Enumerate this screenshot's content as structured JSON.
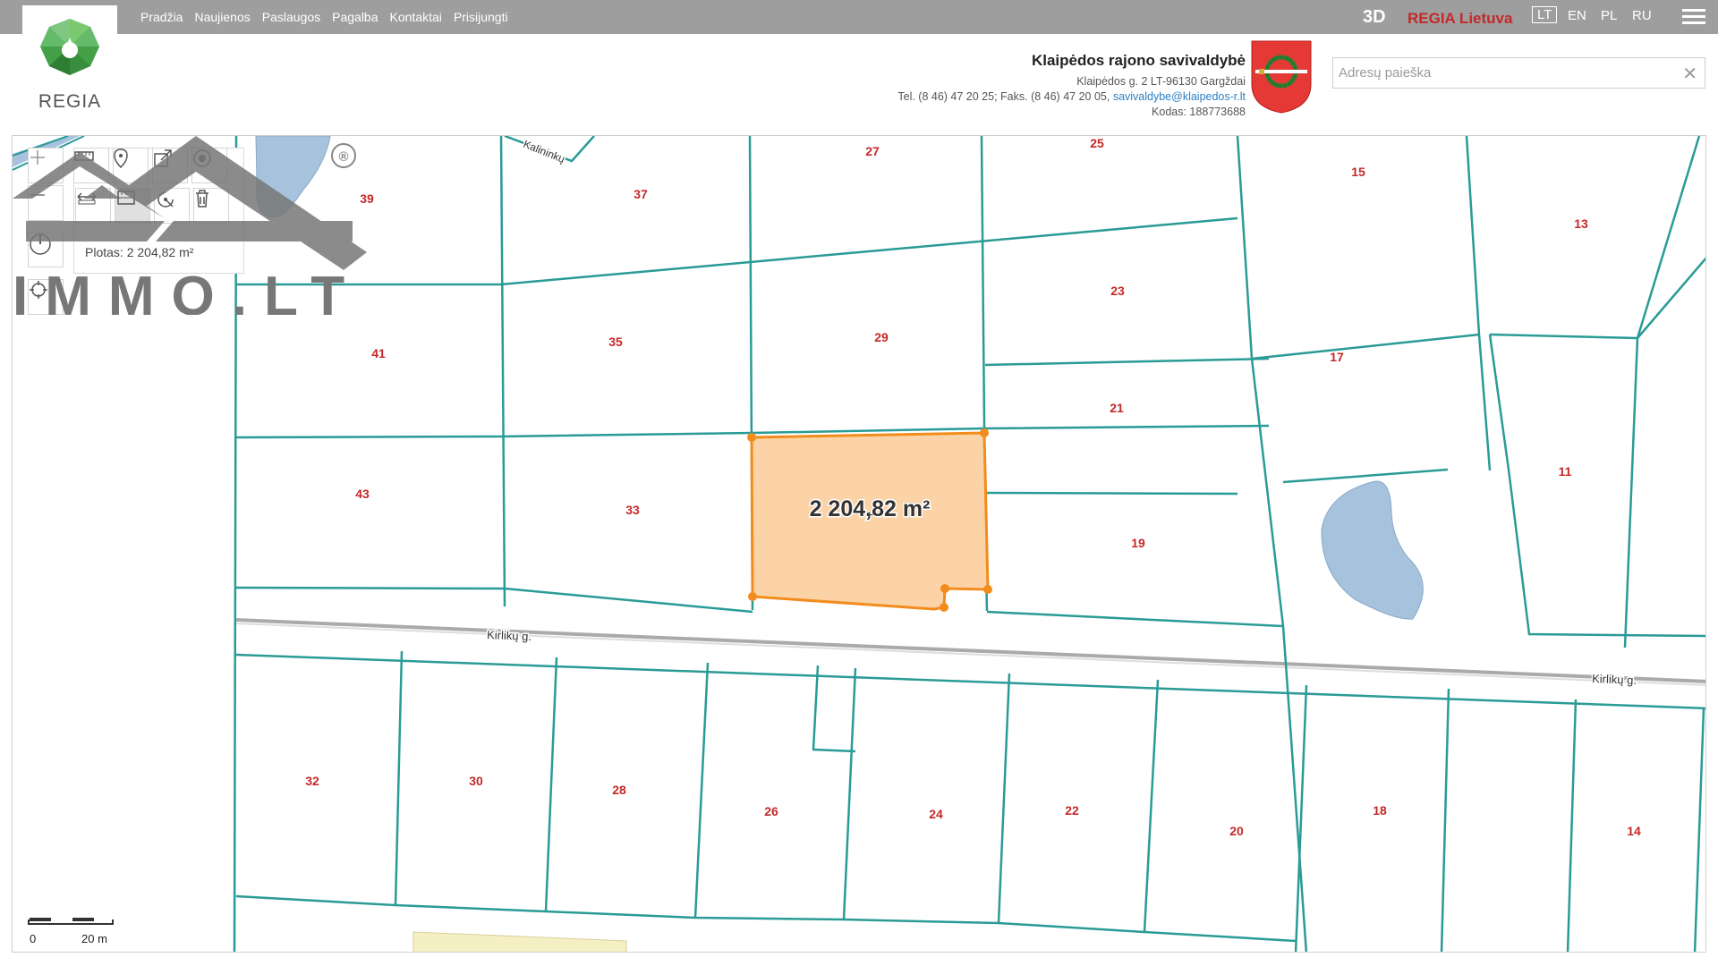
{
  "nav": {
    "items": [
      "Pradžia",
      "Naujienos",
      "Paslaugos",
      "Pagalba",
      "Kontaktai",
      "Prisijungti"
    ]
  },
  "header": {
    "logo_text": "REGIA",
    "btn_3d": "3D",
    "regia_lietuva": "REGIA Lietuva",
    "languages": [
      "LT",
      "EN",
      "PL",
      "RU"
    ],
    "active_language": "LT"
  },
  "municipality": {
    "name": "Klaipėdos rajono savivaldybė",
    "address": "Klaipėdos g. 2 LT-96130 Gargždai",
    "phones": "Tel. (8 46) 47 20 25; Faks. (8 46) 47 20 05,",
    "email": "savivaldybe@klaipedos-r.lt",
    "code": "Kodas: 188773688"
  },
  "search": {
    "placeholder": "Adresų paieška",
    "clear_symbol": "✕"
  },
  "measure": {
    "area_text": "Plotas: 2 204,82 m²",
    "map_label": "2 204,82 m²"
  },
  "map": {
    "colors": {
      "parcel_border": "#2a9b96",
      "selected_fill": "#fbd3a6",
      "selected_stroke": "#f28c1c",
      "water": "#a6c2dc",
      "road": "#aaaaaa",
      "label": "#c62828"
    },
    "streets": [
      "Kirlikų g.",
      "Kirlikų g.",
      "Kalininkų"
    ],
    "parcel_numbers": [
      "39",
      "37",
      "27",
      "25",
      "15",
      "13",
      "41",
      "35",
      "29",
      "23",
      "17",
      "21",
      "43",
      "33",
      "19",
      "11",
      "32",
      "30",
      "28",
      "26",
      "24",
      "22",
      "20",
      "18",
      "14"
    ]
  },
  "scale": {
    "start": "0",
    "end": "20 m"
  },
  "watermark": {
    "text": "IMMO.LT",
    "registered": "®"
  }
}
